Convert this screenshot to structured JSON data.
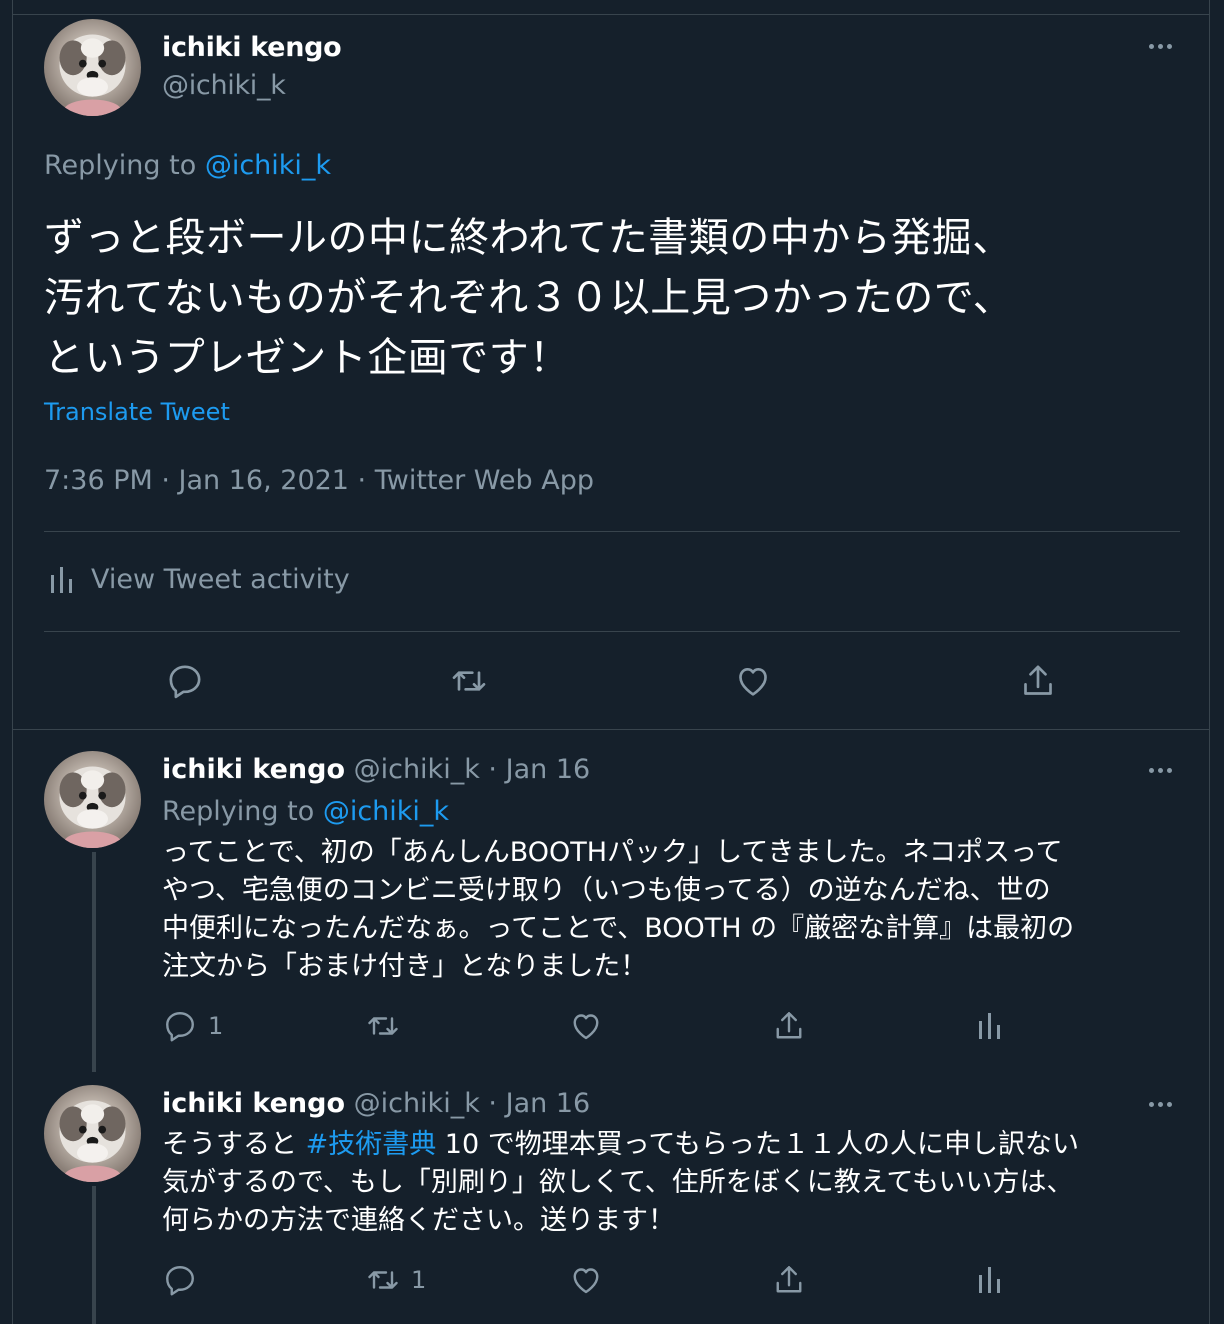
{
  "main_tweet": {
    "author_name": "ichiki kengo",
    "author_handle": "@ichiki_k",
    "replying_label": "Replying to",
    "replying_handle": "@ichiki_k",
    "text_line1": "ずっと段ボールの中に終われてた書類の中から発掘、",
    "text_line2": "汚れてないものがそれぞれ３０以上見つかったので、",
    "text_line3": "というプレゼント企画です！",
    "translate_label": "Translate Tweet",
    "meta": "7:36 PM · Jan 16, 2021 · Twitter Web App",
    "activity_label": "View Tweet activity"
  },
  "replies": [
    {
      "author_name": "ichiki kengo",
      "author_handle": "@ichiki_k",
      "separator": "·",
      "date": "Jan 16",
      "replying_label": "Replying to",
      "replying_handle": "@ichiki_k",
      "line1": "ってことで、初の「あんしんBOOTHパック」してきました。ネコポスって",
      "line2": "やつ、宅急便のコンビニ受け取り（いつも使ってる）の逆なんだね、世の",
      "line3": "中便利になったんだなぁ。ってことで、BOOTH の『厳密な計算』は最初の",
      "line4": "注文から「おまけ付き」となりました！",
      "reply_count": "1",
      "retweet_count": "",
      "like_count": ""
    },
    {
      "author_name": "ichiki kengo",
      "author_handle": "@ichiki_k",
      "separator": "·",
      "date": "Jan 16",
      "line1_prefix": "そうすると ",
      "hashtag": "#技術書典",
      "line1_suffix": " 10 で物理本買ってもらった１１人の人に申し訳ない",
      "line2": "気がするので、もし「別刷り」欲しくて、住所をぼくに教えてもいい方は、",
      "line3": "何らかの方法で連絡ください。送ります！",
      "reply_count": "",
      "retweet_count": "1",
      "like_count": ""
    }
  ],
  "icons": [
    "more-icon",
    "reply-icon",
    "retweet-icon",
    "like-icon",
    "share-icon",
    "analytics-icon"
  ],
  "colors": {
    "background": "#15202b",
    "text": "#ffffff",
    "muted": "#8899a6",
    "link": "#1d9bf0",
    "border": "#38444d"
  }
}
